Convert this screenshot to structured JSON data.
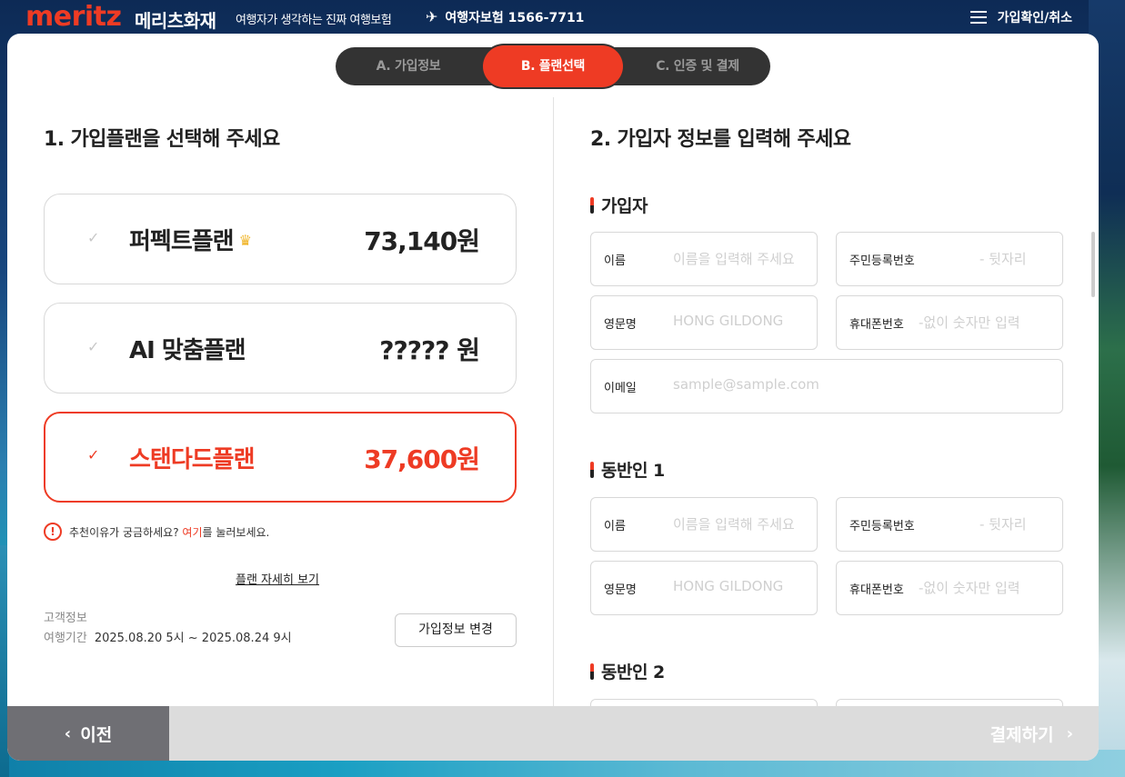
{
  "header": {
    "logo": "meritz",
    "brand_kr": "메리츠화재",
    "tagline": "여행자가 생각하는 진짜 여행보험",
    "hotline": "여행자보험 1566-7711",
    "menu_label": "가입확인/취소"
  },
  "steps": [
    "A. 가입정보",
    "B. 플랜선택",
    "C. 인증 및 결제"
  ],
  "active_step": 1,
  "plans_section": {
    "title": "1. 가입플랜을 선택해 주세요",
    "plans": [
      {
        "name": "퍼펙트플랜",
        "price": "73,140원",
        "selected": false,
        "icon": "crown-icon"
      },
      {
        "name": "AI 맞춤플랜",
        "price": "????? 원",
        "selected": false
      },
      {
        "name": "스탠다드플랜",
        "price": "37,600원",
        "selected": true
      }
    ],
    "notice_pre": "추천이유가 궁금하세요? ",
    "notice_link": "여기",
    "notice_post": "를 눌러보세요.",
    "detail_link": "플랜 자세히 보기",
    "customer_label": "고객정보",
    "period_label": "여행기간",
    "period_value": "2025.08.20 5시 ~ 2025.08.24 9시",
    "change_button": "가입정보 변경"
  },
  "form_section": {
    "title": "2. 가입자 정보를 입력해 주세요",
    "applicant_heading": "가입자",
    "companion1_heading": "동반인 1",
    "companion2_heading": "동반인 2",
    "labels": {
      "name": "이름",
      "rrn": "주민등록번호",
      "eng_name": "영문명",
      "phone": "휴대폰번호",
      "email": "이메일"
    },
    "placeholders": {
      "name": "이름을 입력해 주세요",
      "rrn": "-  뒷자리",
      "eng_name": "HONG GILDONG",
      "phone": "-없이 숫자만 입력",
      "email": "sample@sample.com"
    }
  },
  "footer": {
    "prev": "이전",
    "next": "결제하기"
  },
  "colors": {
    "accent": "#ee3b24",
    "stepper_bg": "#333333",
    "prev_bg": "#6f6f74",
    "footer_bg": "#dcdcdc"
  }
}
